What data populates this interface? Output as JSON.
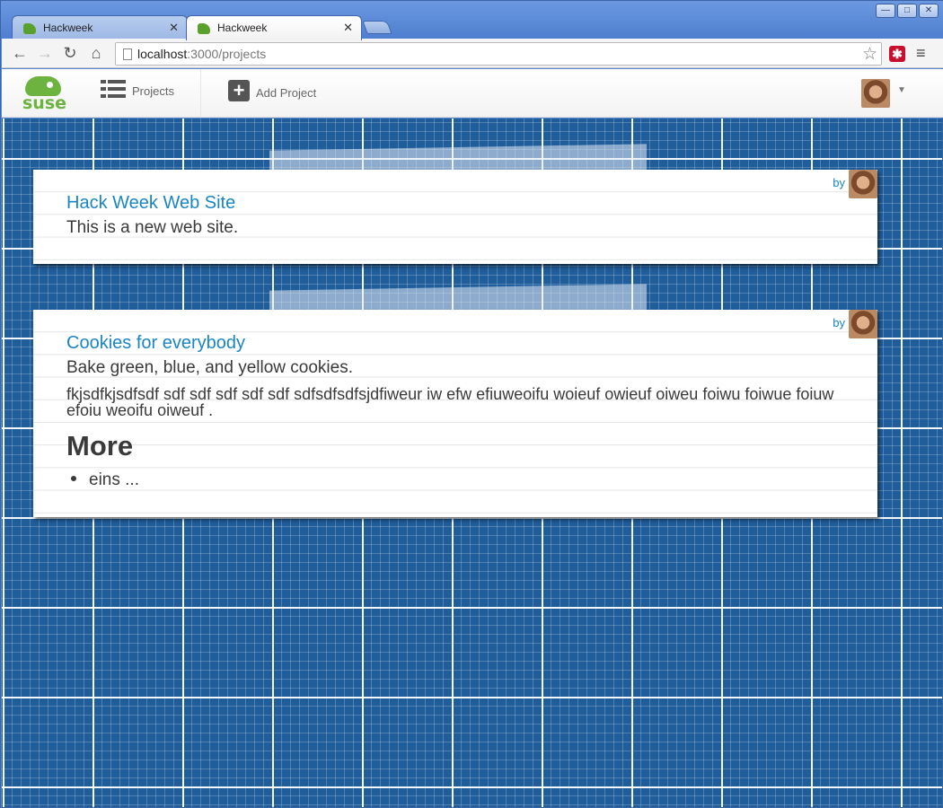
{
  "browser": {
    "tabs": [
      {
        "label": "Hackweek",
        "active": false
      },
      {
        "label": "Hackweek",
        "active": true
      }
    ],
    "url_host": "localhost",
    "url_path": ":3000/projects"
  },
  "header": {
    "logo_text": "suse",
    "nav": {
      "projects_label": "Projects",
      "add_project_label": "Add Project"
    }
  },
  "projects": [
    {
      "by_label": "by",
      "title": "Hack Week Web Site",
      "description": "This is a new web site."
    },
    {
      "by_label": "by",
      "title": "Cookies for everybody",
      "description": "Bake green, blue, and yellow cookies.",
      "body": "fkjsdfkjsdfsdf sdf sdf sdf sdf sdf sdfsdfsdfsjdfiweur iw efw efiuweoifu woieuf owieuf oiweu foiwu foiwue foiuw efoiu weoifu oiweuf .",
      "heading": "More",
      "list": [
        "eins ..."
      ]
    }
  ],
  "colors": {
    "link": "#1a85c4",
    "blueprint": "#1f5d9b",
    "suse_green": "#6db33f"
  }
}
